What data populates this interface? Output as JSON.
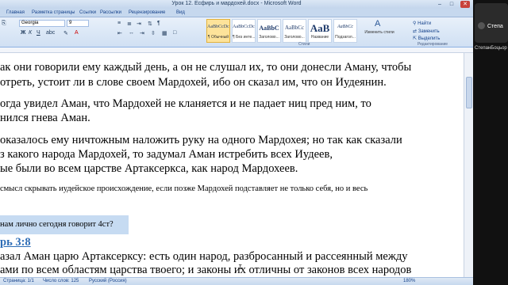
{
  "window": {
    "title": "Урок 12. Есфирь и мардохей.docx - Microsoft Word"
  },
  "tabs": [
    "Главная",
    "Разметка страницы",
    "Ссылки",
    "Рассылки",
    "Рецензирование",
    "Вид"
  ],
  "ribbon": {
    "font_name": "Georgia",
    "font_size": "9",
    "styles": [
      {
        "sample": "AaBbCcDc",
        "name": "¶ Обычный",
        "active": true
      },
      {
        "sample": "AaBbCcDc",
        "name": "¶ Без инте...",
        "active": false
      },
      {
        "sample": "AaBbC",
        "name": "Заголово...",
        "active": false
      },
      {
        "sample": "AaBbCc",
        "name": "Заголово...",
        "active": false
      },
      {
        "sample": "AaB",
        "name": "Название",
        "active": false
      },
      {
        "sample": "AaBbCc",
        "name": "Подзагол...",
        "active": false
      }
    ],
    "change_styles": "Изменить стили",
    "styles_group": "Стили",
    "edit": {
      "find": "Найти",
      "replace": "Заменить",
      "select": "Выделить"
    },
    "edit_group": "Редактирование"
  },
  "document": {
    "lines": [
      {
        "text": "ак они говорили ему каждый день, а он не слушал их, то они донесли Аману, чтобы",
        "kind": "body"
      },
      {
        "text": "отреть, устоит ли в слове своем Мардохей, ибо он сказал им, что он Иудеянин.",
        "kind": "body"
      },
      {
        "text": "огда увидел Аман, что Мардохей не кланяется и не падает ниц пред ним, то",
        "kind": "body"
      },
      {
        "text": "нился гнева Аман.",
        "kind": "body"
      },
      {
        "text": "оказалось ему ничтожным наложить руку на одного Мардохея; но так как сказали",
        "kind": "body"
      },
      {
        "text": "з какого народа Мардохей, то задумал Аман истребить всех Иудеев,",
        "kind": "body"
      },
      {
        "text": "ые были во всем царстве Артаксеркса, как народ Мардохеев.",
        "kind": "body"
      },
      {
        "text": "смысл скрывать иудейское происхождение, если позже Мардохей подставляет не только себя, но и весь",
        "kind": "small"
      },
      {
        "text": "нам лично сегодня говорит 4ст?",
        "kind": "selected"
      },
      {
        "text": "рь 3:8",
        "kind": "heading"
      },
      {
        "text": "азал Аман царю Артаксерксу: есть один народ, разбросанный и рассеянный между",
        "kind": "body"
      },
      {
        "text": "ами по всем областям царства твоего; и законы их отличны от законов всех народов",
        "kind": "body"
      }
    ]
  },
  "status": {
    "page": "1/1",
    "words": "125",
    "language": "Русский (Россия)",
    "zoom": "180%"
  },
  "call_panel": {
    "participant1": "Степа",
    "participant2": "СтепанБоцьор"
  }
}
